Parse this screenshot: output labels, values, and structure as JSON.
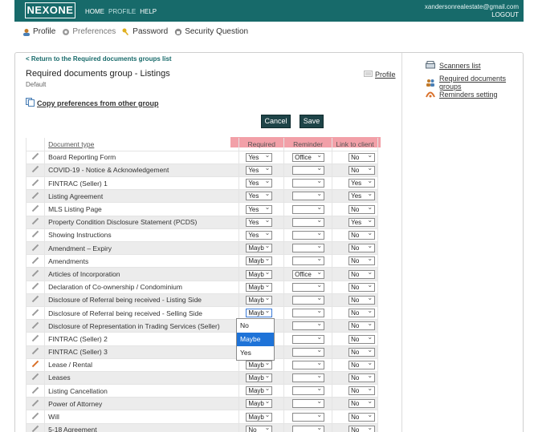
{
  "header": {
    "logo": "NEXONE",
    "nav": [
      {
        "label": "HOME",
        "active": true
      },
      {
        "label": "PROFILE",
        "active": false
      },
      {
        "label": "HELP",
        "active": true
      }
    ],
    "email": "xandersonrealestate@gmail.com",
    "logout": "LOGOUT",
    "color": "#176a6a"
  },
  "subnav": {
    "items": [
      {
        "label": "Profile",
        "icon": "profile-icon"
      },
      {
        "label": "Preferences",
        "icon": "gear-icon"
      },
      {
        "label": "Password",
        "icon": "key-icon"
      },
      {
        "label": "Security Question",
        "icon": "lock-icon"
      }
    ]
  },
  "main": {
    "back_link": "< Return to the Required documents groups list",
    "title": "Required documents group - Listings",
    "subtitle": "Default",
    "profile_link": "Profile",
    "copy_link": "Copy preferences from other group",
    "cancel": "Cancel",
    "save": "Save"
  },
  "table": {
    "headers": {
      "document": "Document type",
      "required": "Required",
      "reminder": "Reminder",
      "link": "Link to client"
    },
    "rows": [
      {
        "name": "Board Reporting Form",
        "required": "Yes",
        "reminder": "Office",
        "link": "No"
      },
      {
        "name": "COVID-19 - Notice & Acknowledgement",
        "required": "Yes",
        "reminder": "",
        "link": "No"
      },
      {
        "name": "FINTRAC (Seller) 1",
        "required": "Yes",
        "reminder": "",
        "link": "Yes"
      },
      {
        "name": "Listing Agreement",
        "required": "Yes",
        "reminder": "",
        "link": "Yes"
      },
      {
        "name": "MLS Listing Page",
        "required": "Yes",
        "reminder": "",
        "link": "No"
      },
      {
        "name": "Property Condition Disclosure Statement (PCDS)",
        "required": "Yes",
        "reminder": "",
        "link": "Yes"
      },
      {
        "name": "Showing Instructions",
        "required": "Yes",
        "reminder": "",
        "link": "No"
      },
      {
        "name": "Amendment – Expiry",
        "required": "Mayb",
        "reminder": "",
        "link": "No"
      },
      {
        "name": "Amendments",
        "required": "Mayb",
        "reminder": "",
        "link": "No"
      },
      {
        "name": "Articles of Incorporation",
        "required": "Mayb",
        "reminder": "Office",
        "link": "No"
      },
      {
        "name": "Declaration of Co-ownership / Condominium",
        "required": "Mayb",
        "reminder": "",
        "link": "No"
      },
      {
        "name": "Disclosure of Referral being received - Listing Side",
        "required": "Mayb",
        "reminder": "",
        "link": "No"
      },
      {
        "name": "Disclosure of Referral being received - Selling Side",
        "required": "Mayb",
        "reminder": "",
        "link": "No"
      },
      {
        "name": "Disclosure of Representation in Trading Services (Seller)",
        "required": "",
        "reminder": "",
        "link": "No"
      },
      {
        "name": "FINTRAC (Seller) 2",
        "required": "",
        "reminder": "",
        "link": "No"
      },
      {
        "name": "FINTRAC (Seller) 3",
        "required": "",
        "reminder": "",
        "link": "No"
      },
      {
        "name": "Lease / Rental",
        "required": "Mayb",
        "reminder": "",
        "link": "No"
      },
      {
        "name": "Leases",
        "required": "Mayb",
        "reminder": "",
        "link": "No"
      },
      {
        "name": "Listing Cancellation",
        "required": "Mayb",
        "reminder": "",
        "link": "No"
      },
      {
        "name": "Power of Attorney",
        "required": "Mayb",
        "reminder": "",
        "link": "No"
      },
      {
        "name": "Will",
        "required": "Mayb",
        "reminder": "",
        "link": "No"
      },
      {
        "name": "5-18 Agreement",
        "required": "No",
        "reminder": "",
        "link": "No"
      }
    ]
  },
  "dropdown": {
    "options": [
      "No",
      "Maybe",
      "Yes"
    ],
    "highlighted": "Maybe"
  },
  "sidebar": {
    "links": [
      {
        "label": "Scanners list",
        "icon": "scanner-icon"
      },
      {
        "label": "Required documents groups",
        "icon": "users-icon"
      },
      {
        "label": "Reminders setting",
        "icon": "reminder-icon"
      }
    ]
  }
}
